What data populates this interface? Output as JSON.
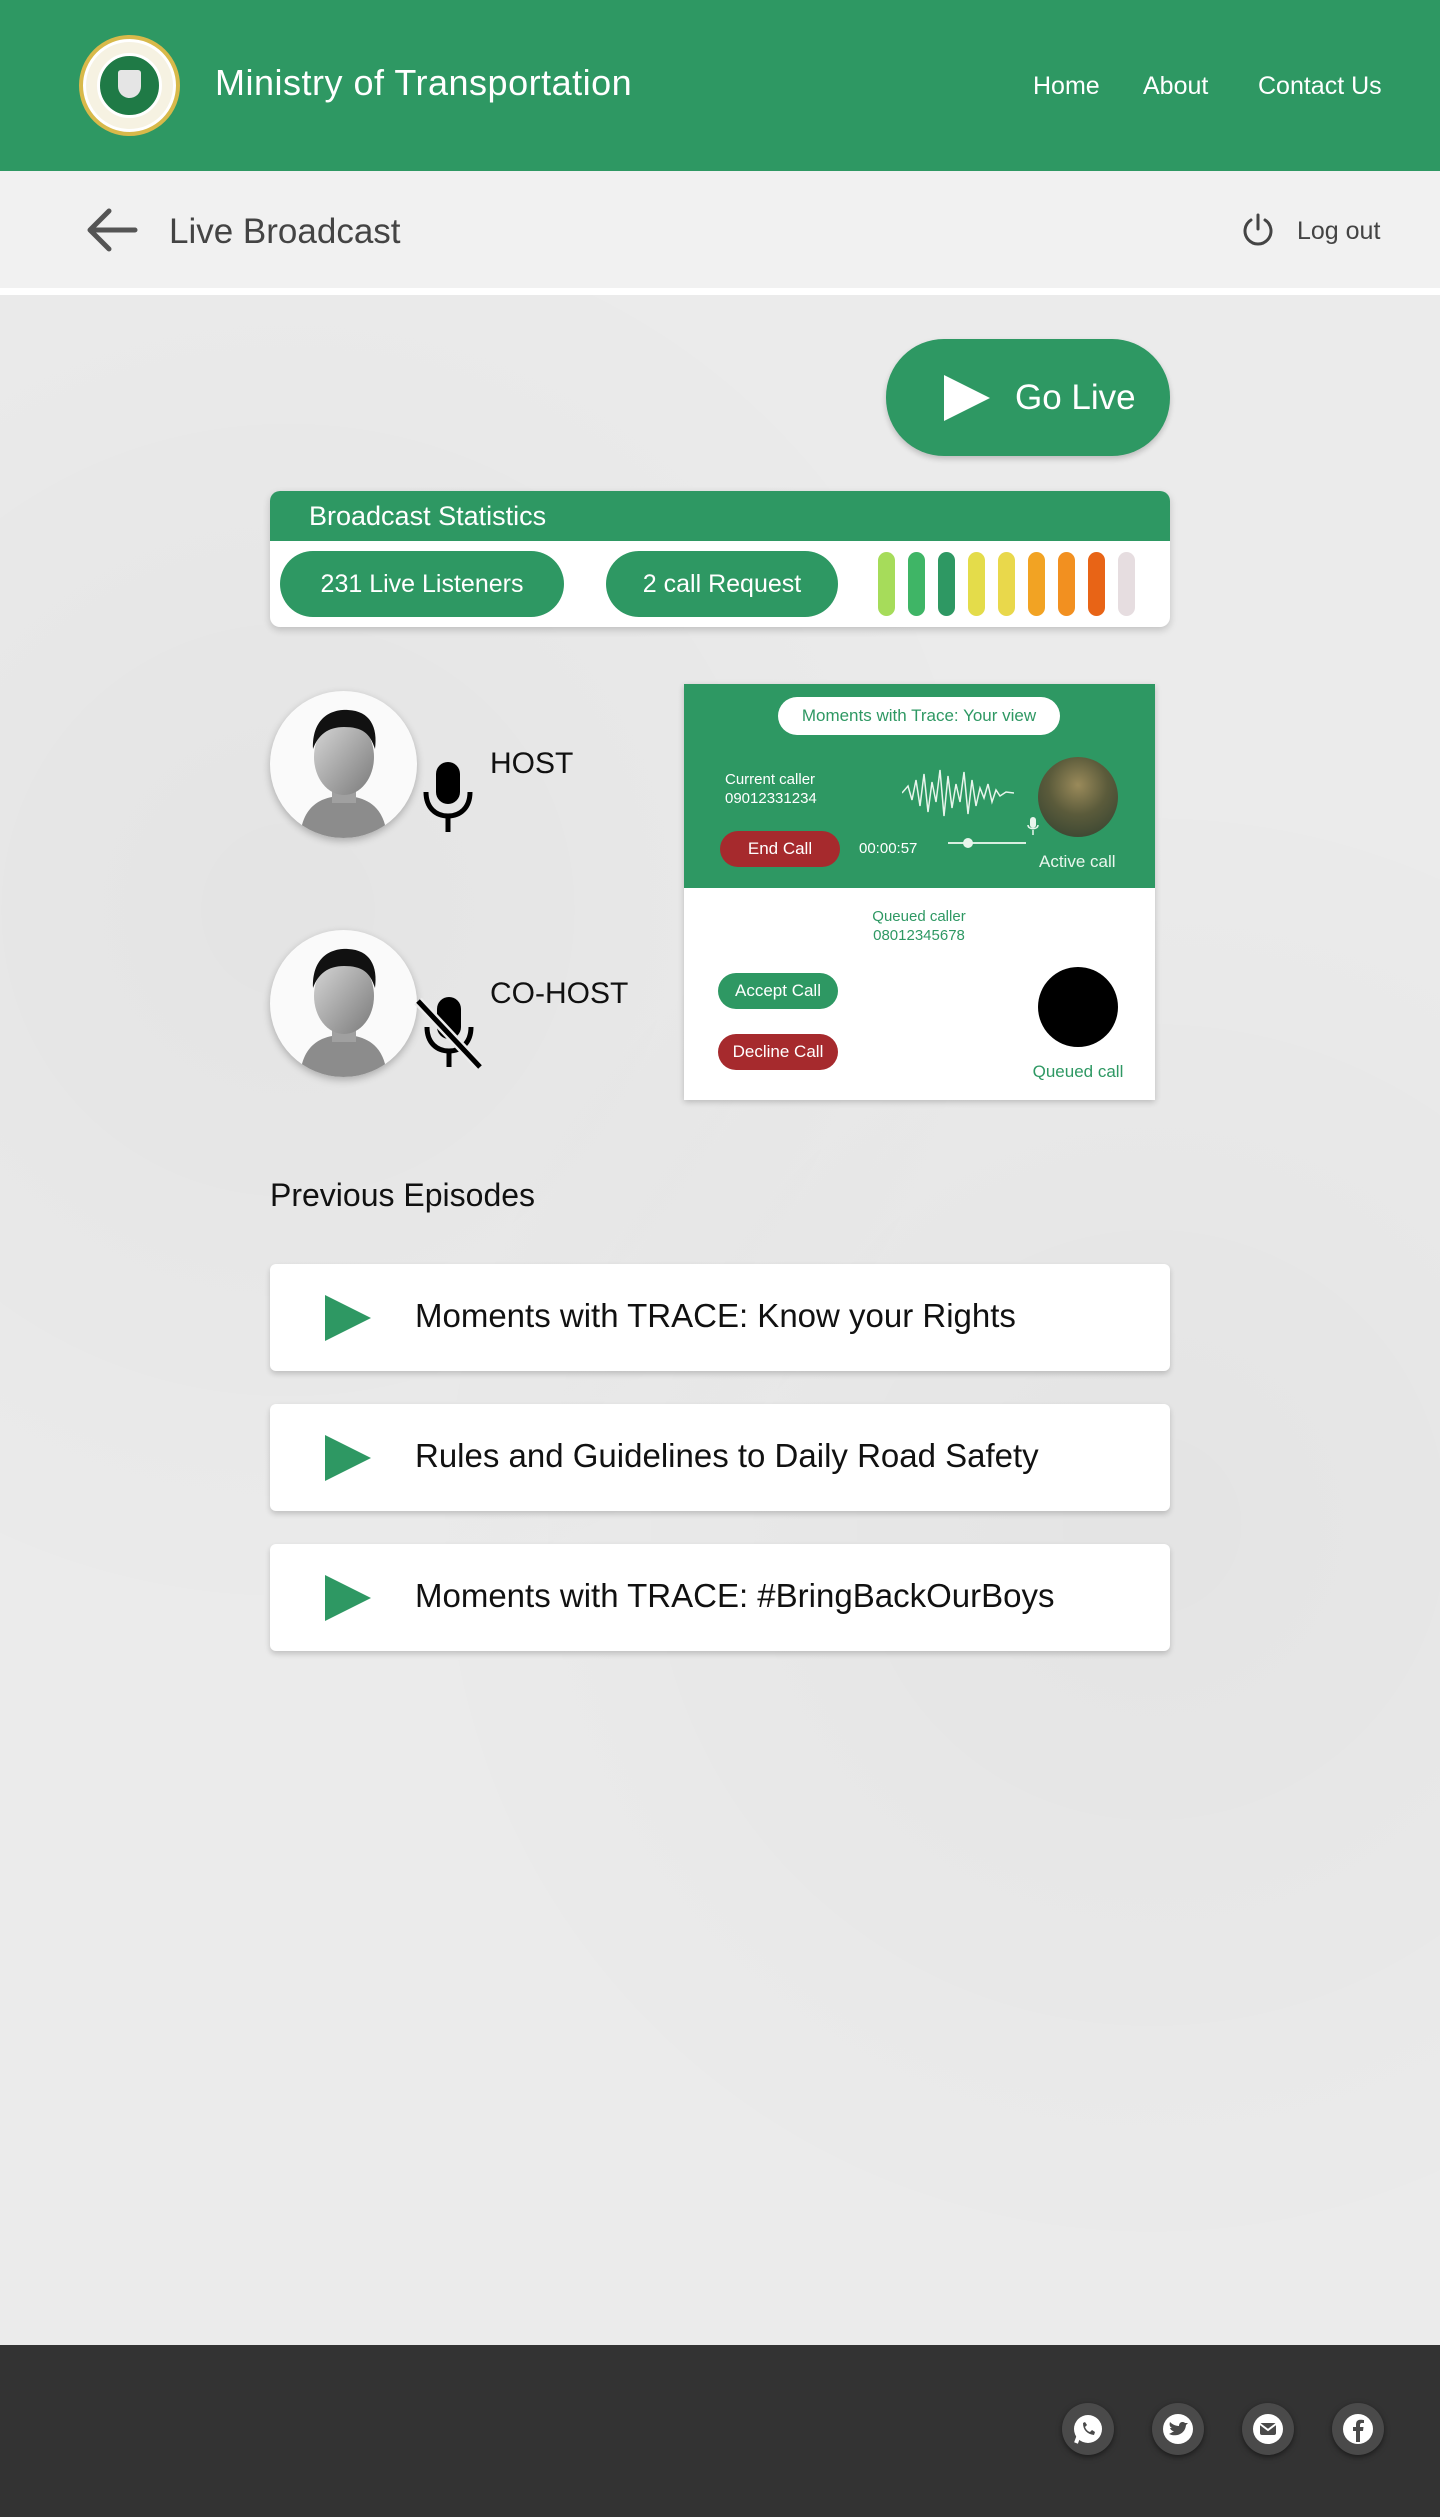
{
  "header": {
    "title": "Ministry of Transportation",
    "logo": "ogun-state-crest",
    "nav": [
      "Home",
      "About",
      "Contact Us"
    ]
  },
  "subbar": {
    "title": "Live Broadcast",
    "logout_label": "Log out"
  },
  "go_live_label": "Go Live",
  "stats": {
    "title": "Broadcast Statistics",
    "listeners": "231 Live Listeners",
    "call_requests": "2 call Request",
    "level_colors": [
      "#a6dc5a",
      "#3fb566",
      "#2e9863",
      "#e4dc4a",
      "#e9d84b",
      "#f2a323",
      "#f29020",
      "#e86416",
      "#e6dde0"
    ]
  },
  "hosts": {
    "host_label": "HOST",
    "cohost_label": "CO-HOST"
  },
  "host_view": {
    "title": "Moments with Trace: Your view",
    "current_caller_label": "Current caller",
    "current_caller_number": "09012331234",
    "end_call": "End Call",
    "duration": "00:00:57",
    "active_call": "Active call",
    "queued_caller_label": "Queued caller",
    "queued_caller_number": "08012345678",
    "accept_call": "Accept Call",
    "decline_call": "Decline Call",
    "queued_call": "Queued call"
  },
  "episodes": {
    "title": "Previous Episodes",
    "items": [
      "Moments with TRACE: Know your Rights",
      "Rules and Guidelines to Daily Road Safety",
      "Moments with TRACE: #BringBackOurBoys"
    ]
  },
  "footer": {
    "social": [
      "whatsapp-icon",
      "twitter-icon",
      "mail-icon",
      "facebook-icon"
    ]
  },
  "colors": {
    "brand_green": "#2e9863",
    "danger_red": "#a62a2d",
    "footer_dark": "#333333"
  }
}
